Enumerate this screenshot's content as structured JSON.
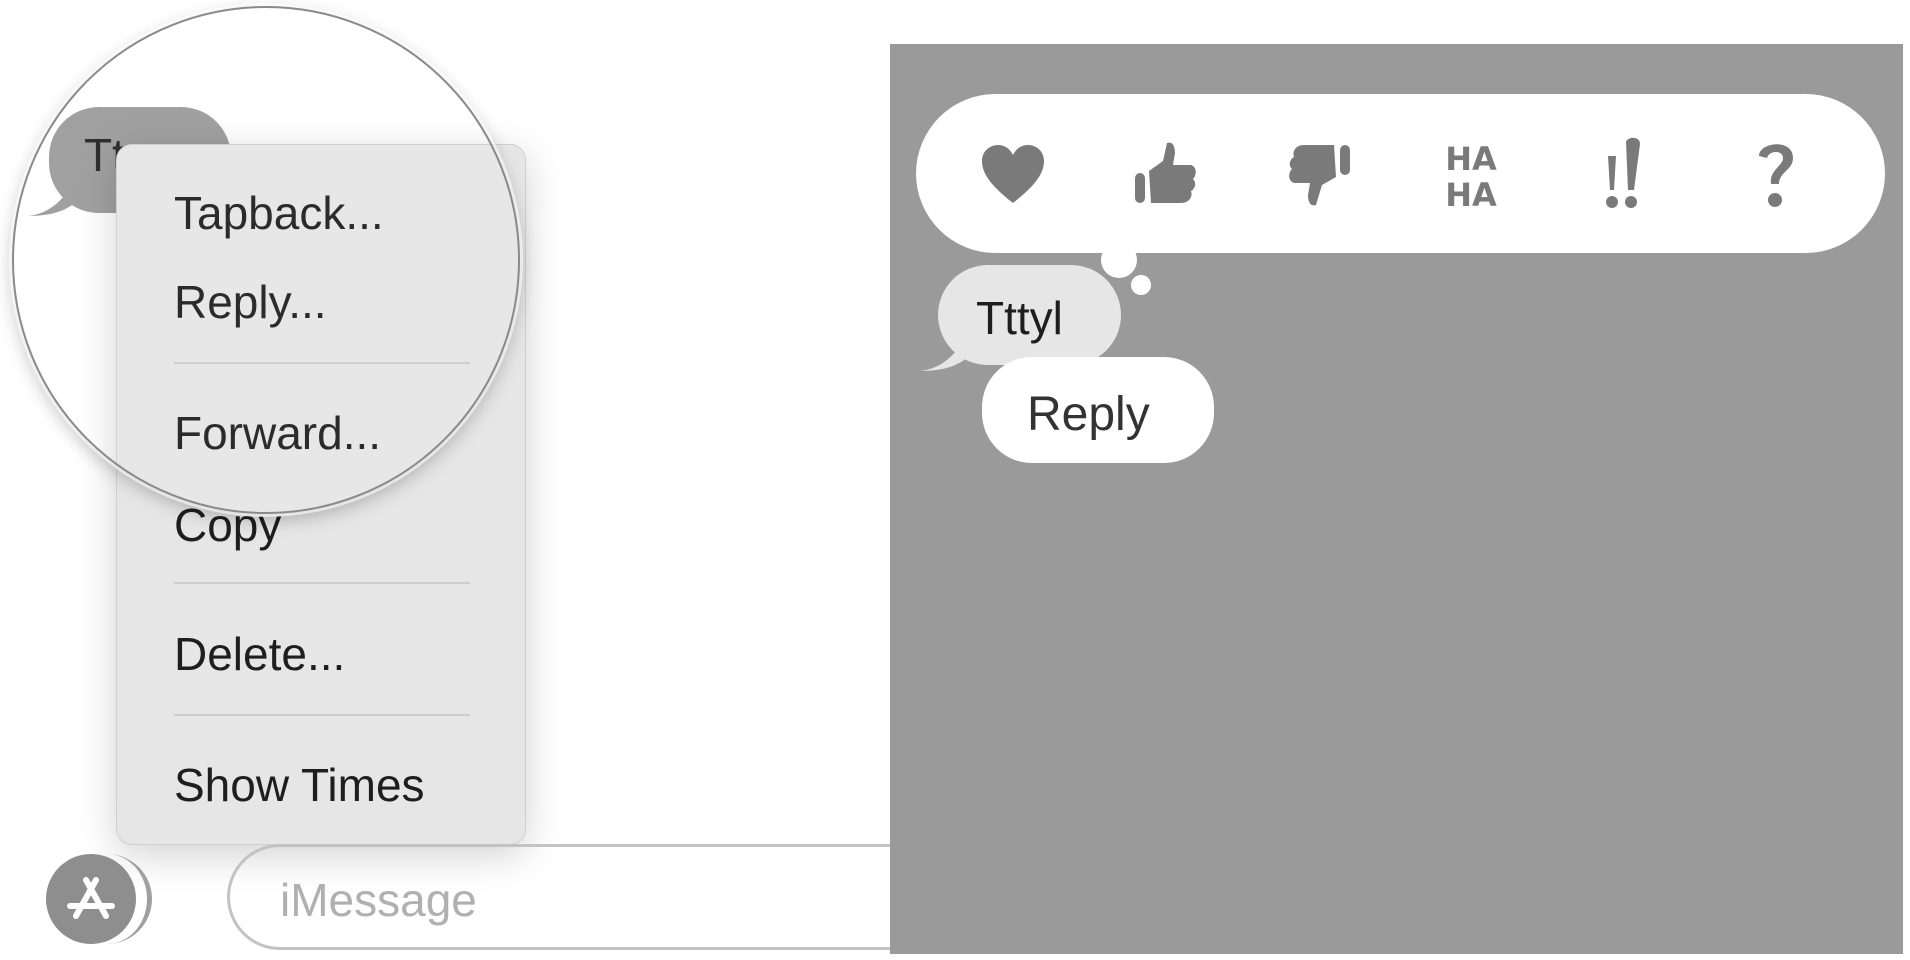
{
  "left": {
    "message_bubble_text": "Tt",
    "context_menu": {
      "items": [
        "Tapback...",
        "Reply...",
        "Forward...",
        "Copy",
        "Delete...",
        "Show Times"
      ]
    },
    "apps_button_icon": "app-store-icon",
    "input": {
      "placeholder": "iMessage"
    }
  },
  "right": {
    "tapbacks": [
      {
        "name": "heart",
        "icon": "heart-icon"
      },
      {
        "name": "thumbs-up",
        "icon": "thumbs-up-icon"
      },
      {
        "name": "thumbs-down",
        "icon": "thumbs-down-icon"
      },
      {
        "name": "haha",
        "icon": "haha-icon",
        "label": "HA HA"
      },
      {
        "name": "exclamation",
        "icon": "double-exclamation-icon",
        "label": "!!"
      },
      {
        "name": "question",
        "icon": "question-icon",
        "label": "?"
      }
    ],
    "message_text": "Tttyl",
    "reply_button": "Reply"
  },
  "colors": {
    "panel": "#9a9a9a",
    "icon": "#7a7a7a",
    "menu": "#e6e6e6"
  }
}
